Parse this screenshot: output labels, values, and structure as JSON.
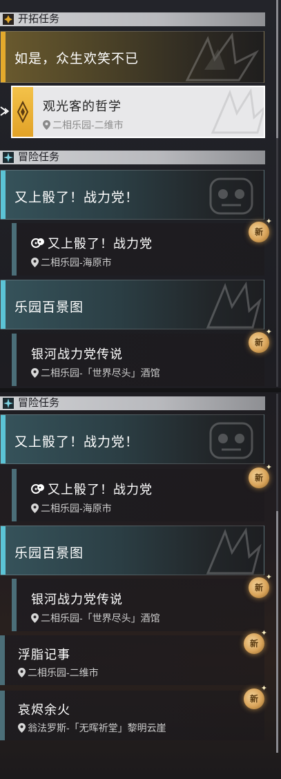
{
  "sections": {
    "trailblaze": {
      "header": "开拓任务"
    },
    "adventure_a": {
      "header": "冒险任务"
    },
    "adventure_b": {
      "header": "冒险任务"
    }
  },
  "trailblaze": {
    "main_title": "如是，众生欢笑不已",
    "sub_title": "观光客的哲学",
    "sub_location": "二相乐园-二维市"
  },
  "adventure_a": {
    "group1_title": "又上骰了！战力党！",
    "group1_quest_title": "又上骰了！战力党",
    "group1_quest_location": "二相乐园-海原市",
    "group2_title": "乐园百景图",
    "group2_quest_title": "银河战力党传说",
    "group2_quest_location": "二相乐园-「世界尽头」酒馆"
  },
  "adventure_b": {
    "group1_title": "又上骰了！战力党！",
    "group1_quest_title": "又上骰了！战力党",
    "group1_quest_location": "二相乐园-海原市",
    "group2_title": "乐园百景图",
    "group2_quest_title": "银河战力党传说",
    "group2_quest_location": "二相乐园-「世界尽头」酒馆",
    "quest3_title": "浮脂记事",
    "quest3_location": "二相乐园-二维市",
    "quest4_title": "哀烬余火",
    "quest4_location": "翁法罗斯-「无晖祈堂」黎明云崖"
  },
  "badges": {
    "new_label": "新"
  },
  "icons": {
    "trailblaze_header": "trailblaze-diamond-icon",
    "adventure_header": "adventure-star-icon",
    "location": "location-pin-icon",
    "track_quest": "track-arrow-icon",
    "party_dice": "dice-emblem-icon"
  },
  "colors": {
    "trailblaze_accent": "#e3a92c",
    "adventure_accent": "#5bc4d6",
    "new_badge": "#e0ad62"
  }
}
